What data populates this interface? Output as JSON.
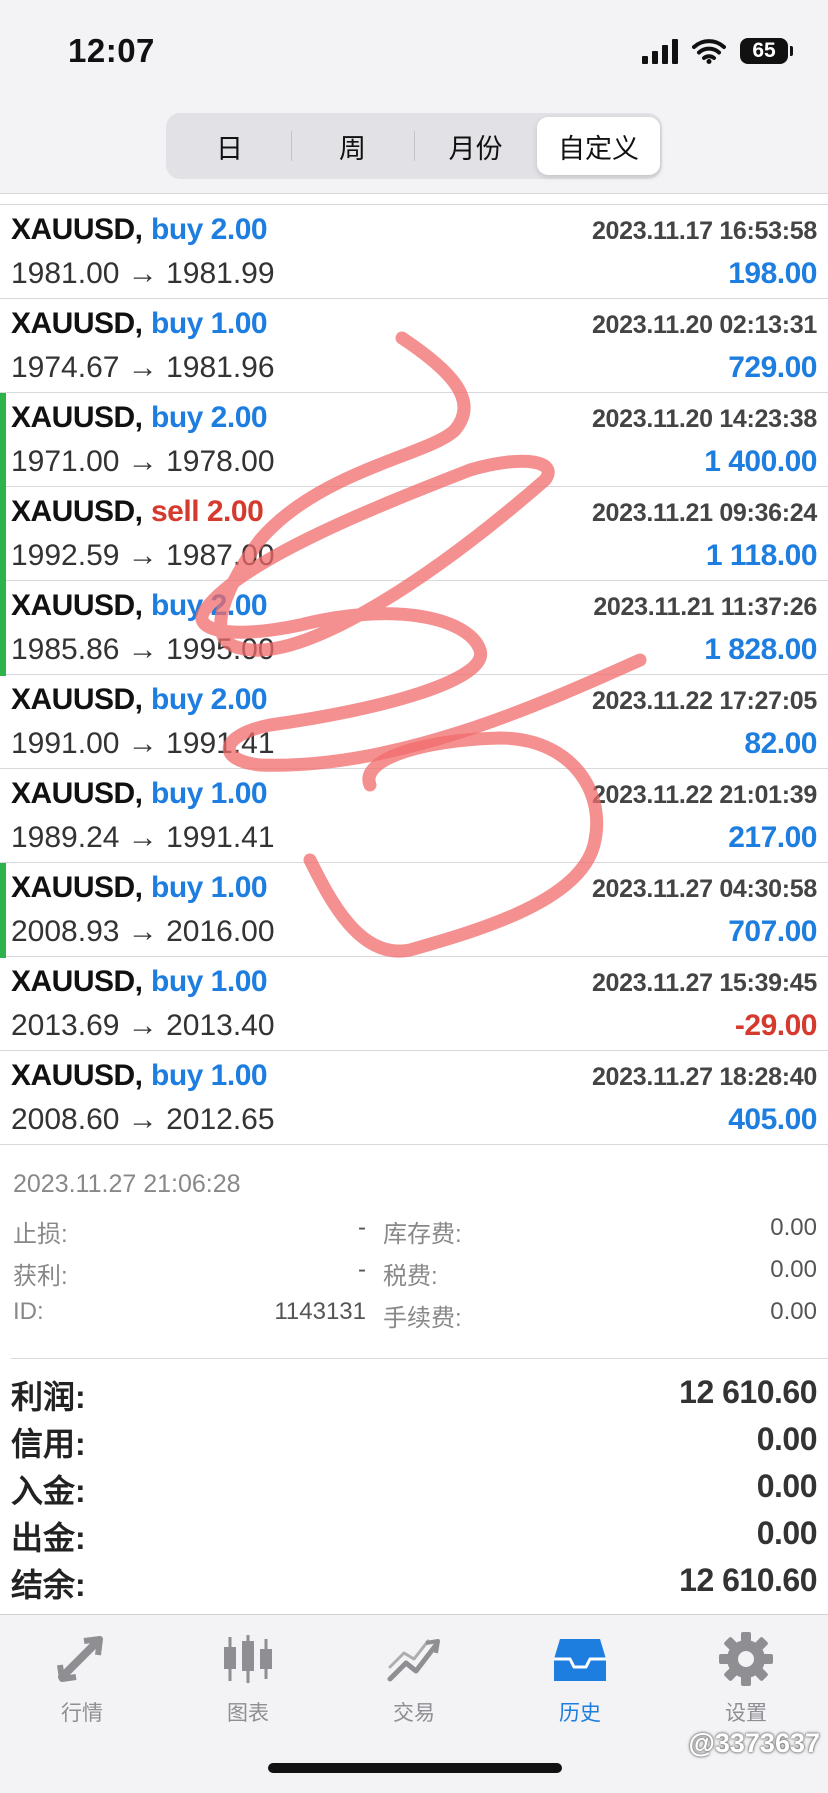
{
  "status_bar": {
    "time": "12:07",
    "battery": "65"
  },
  "periods": [
    {
      "label": "日",
      "active": false
    },
    {
      "label": "周",
      "active": false
    },
    {
      "label": "月份",
      "active": false
    },
    {
      "label": "自定义",
      "active": true
    }
  ],
  "trades": [
    {
      "symbol": "XAUUSD,",
      "side": "buy",
      "volume": "buy 2.00",
      "datetime": "2023.11.17 16:53:58",
      "prices": "1981.00 → 1981.99",
      "profit": "198.00",
      "marked": false
    },
    {
      "symbol": "XAUUSD,",
      "side": "buy",
      "volume": "buy 1.00",
      "datetime": "2023.11.20 02:13:31",
      "prices": "1974.67 → 1981.96",
      "profit": "729.00",
      "marked": false
    },
    {
      "symbol": "XAUUSD,",
      "side": "buy",
      "volume": "buy 2.00",
      "datetime": "2023.11.20 14:23:38",
      "prices": "1971.00 → 1978.00",
      "profit": "1 400.00",
      "marked": true
    },
    {
      "symbol": "XAUUSD,",
      "side": "sell",
      "volume": "sell 2.00",
      "datetime": "2023.11.21 09:36:24",
      "prices": "1992.59 → 1987.00",
      "profit": "1 118.00",
      "marked": true
    },
    {
      "symbol": "XAUUSD,",
      "side": "buy",
      "volume": "buy 2.00",
      "datetime": "2023.11.21 11:37:26",
      "prices": "1985.86 → 1995.00",
      "profit": "1 828.00",
      "marked": true
    },
    {
      "symbol": "XAUUSD,",
      "side": "buy",
      "volume": "buy 2.00",
      "datetime": "2023.11.22 17:27:05",
      "prices": "1991.00 → 1991.41",
      "profit": "82.00",
      "marked": false
    },
    {
      "symbol": "XAUUSD,",
      "side": "buy",
      "volume": "buy 1.00",
      "datetime": "2023.11.22 21:01:39",
      "prices": "1989.24 → 1991.41",
      "profit": "217.00",
      "marked": false
    },
    {
      "symbol": "XAUUSD,",
      "side": "buy",
      "volume": "buy 1.00",
      "datetime": "2023.11.27 04:30:58",
      "prices": "2008.93 → 2016.00",
      "profit": "707.00",
      "marked": true
    },
    {
      "symbol": "XAUUSD,",
      "side": "buy",
      "volume": "buy 1.00",
      "datetime": "2023.11.27 15:39:45",
      "prices": "2013.69 → 2013.40",
      "profit": "-29.00",
      "marked": false
    },
    {
      "symbol": "XAUUSD,",
      "side": "buy",
      "volume": "buy 1.00",
      "datetime": "2023.11.27 18:28:40",
      "prices": "2008.60 → 2012.65",
      "profit": "405.00",
      "marked": false
    }
  ],
  "detail": {
    "close_time": "2023.11.27 21:06:28",
    "stop_loss_label": "止损:",
    "stop_loss": "-",
    "swap_label": "库存费:",
    "swap": "0.00",
    "take_profit_label": "获利:",
    "take_profit": "-",
    "tax_label": "税费:",
    "tax": "0.00",
    "id_label": "ID:",
    "id": "1143131",
    "commission_label": "手续费:",
    "commission": "0.00"
  },
  "summary": [
    {
      "label": "利润:",
      "value": "12 610.60"
    },
    {
      "label": "信用:",
      "value": "0.00"
    },
    {
      "label": "入金:",
      "value": "0.00"
    },
    {
      "label": "出金:",
      "value": "0.00"
    },
    {
      "label": "结余:",
      "value": "12 610.60"
    }
  ],
  "tabs": [
    {
      "label": "行情",
      "icon": "quotes-icon",
      "active": false
    },
    {
      "label": "图表",
      "icon": "chart-icon",
      "active": false
    },
    {
      "label": "交易",
      "icon": "trade-icon",
      "active": false
    },
    {
      "label": "历史",
      "icon": "history-icon",
      "active": true
    },
    {
      "label": "设置",
      "icon": "settings-icon",
      "active": false
    }
  ],
  "watermark": "@3373637",
  "colors": {
    "buy": "#1e7ee0",
    "sell": "#d43a2d",
    "marker": "#2db34a",
    "scribble": "#f26b6b"
  }
}
